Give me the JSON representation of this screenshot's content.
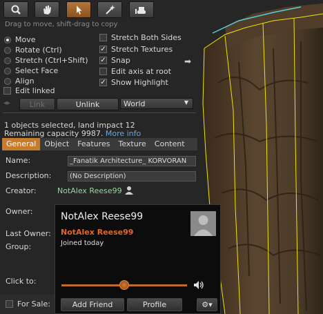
{
  "toolbar": {
    "tools": [
      {
        "name": "focus-tool",
        "icon": "magnifier-icon"
      },
      {
        "name": "move-tool",
        "icon": "hand-icon"
      },
      {
        "name": "edit-tool",
        "icon": "arrow-pointer-icon",
        "active": true
      },
      {
        "name": "create-tool",
        "icon": "magic-wand-icon"
      },
      {
        "name": "land-tool",
        "icon": "bulldozer-icon"
      }
    ]
  },
  "hint": "Drag to move, shift-drag to copy",
  "modes": [
    {
      "label": "Move",
      "selected": true
    },
    {
      "label": "Rotate (Ctrl)",
      "selected": false
    },
    {
      "label": "Stretch (Ctrl+Shift)",
      "selected": false
    },
    {
      "label": "Select Face",
      "selected": false
    },
    {
      "label": "Align",
      "selected": false
    }
  ],
  "edit_linked": {
    "label": "Edit linked",
    "checked": false
  },
  "options": [
    {
      "label": "Stretch Both Sides",
      "checked": false
    },
    {
      "label": "Stretch Textures",
      "checked": true
    },
    {
      "label": "Snap",
      "checked": true
    },
    {
      "label": "Edit axis at root",
      "checked": false
    },
    {
      "label": "Show Highlight",
      "checked": true
    }
  ],
  "link_buttons": {
    "link": "Link",
    "unlink": "Unlink",
    "ruler": "World"
  },
  "status": {
    "line1": "1 objects selected, land impact 12",
    "line2_prefix": "Remaining capacity 9987.",
    "more_info": "More info"
  },
  "tabs": [
    "General",
    "Object",
    "Features",
    "Texture",
    "Content"
  ],
  "general": {
    "name_label": "Name:",
    "name_value": "_Fanatik Architecture_ KORVORAN",
    "description_label": "Description:",
    "description_value": "(No Description)",
    "creator_label": "Creator:",
    "creator_value": "NotAlex Reese99",
    "owner_label": "Owner:",
    "last_owner_label": "Last Owner:",
    "group_label": "Group:",
    "click_to_label": "Click to:",
    "for_sale_label": "For Sale:"
  },
  "profile_popup": {
    "display_name": "NotAlex Reese99",
    "username": "NotAlex Reese99",
    "joined": "Joined today",
    "volume": 0.5,
    "add_friend": "Add Friend",
    "profile": "Profile",
    "accent": "#e0662a"
  },
  "colors": {
    "accent_tab": "#c97b2c",
    "link": "#6aa6e0",
    "highlight": "#f2e600"
  }
}
